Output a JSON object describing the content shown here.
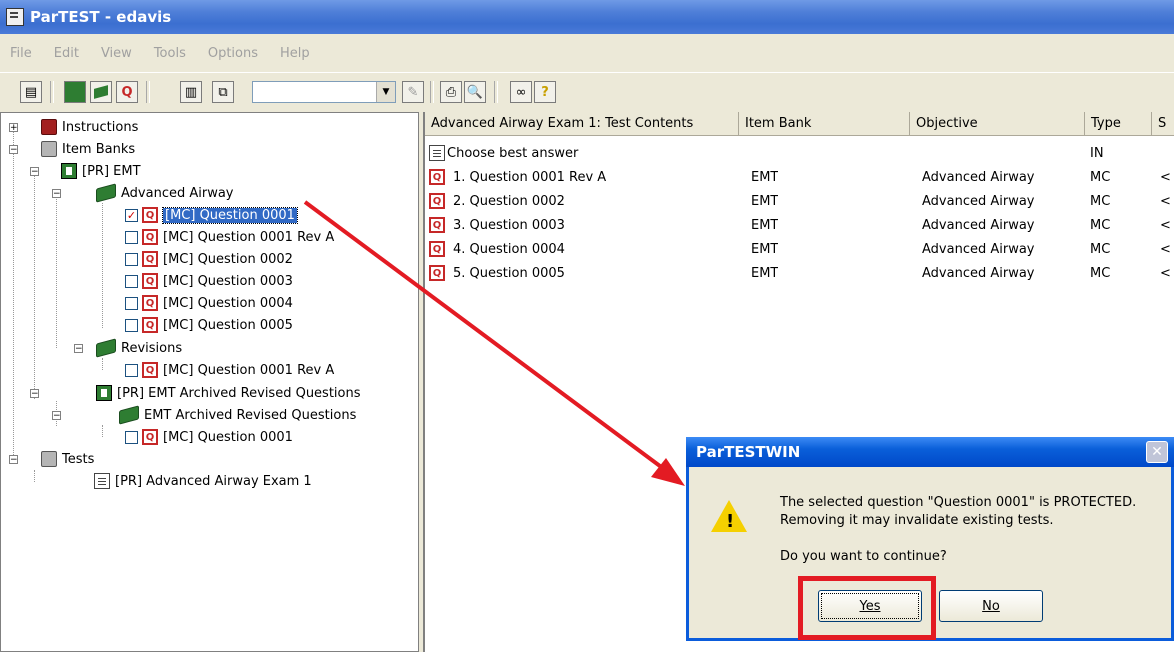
{
  "window": {
    "title": "ParTEST - edavis"
  },
  "menu": [
    "File",
    "Edit",
    "View",
    "Tools",
    "Options",
    "Help"
  ],
  "tree": {
    "instructions": "Instructions",
    "item_banks": "Item Banks",
    "emt_bank": "[PR] EMT",
    "advanced_airway": "Advanced Airway",
    "questions": [
      "[MC] Question 0001",
      "[MC] Question 0001 Rev A",
      "[MC] Question 0002",
      "[MC] Question 0003",
      "[MC] Question 0004",
      "[MC] Question 0005"
    ],
    "revisions": "Revisions",
    "revision_item": "[MC] Question 0001 Rev A",
    "archived_bank": "[PR] EMT Archived Revised Questions",
    "archived_objective": "EMT Archived Revised Questions",
    "archived_item": "[MC] Question 0001",
    "tests": "Tests",
    "test_item": "[PR] Advanced Airway Exam 1"
  },
  "grid": {
    "headers": [
      "Advanced Airway Exam 1: Test Contents",
      "Item Bank",
      "Objective",
      "Type",
      "S"
    ],
    "rows": [
      {
        "name": "Choose best answer",
        "bank": "",
        "objective": "",
        "type": "IN",
        "extra": ""
      },
      {
        "name": "1. Question 0001 Rev A",
        "bank": "EMT",
        "objective": "Advanced Airway",
        "type": "MC",
        "extra": "<"
      },
      {
        "name": "2. Question 0002",
        "bank": "EMT",
        "objective": "Advanced Airway",
        "type": "MC",
        "extra": "<"
      },
      {
        "name": "3. Question 0003",
        "bank": "EMT",
        "objective": "Advanced Airway",
        "type": "MC",
        "extra": "<"
      },
      {
        "name": "4. Question 0004",
        "bank": "EMT",
        "objective": "Advanced Airway",
        "type": "MC",
        "extra": "<"
      },
      {
        "name": "5. Question 0005",
        "bank": "EMT",
        "objective": "Advanced Airway",
        "type": "MC",
        "extra": "<"
      }
    ]
  },
  "dialog": {
    "title": "ParTESTWIN",
    "line1": "The selected question \"Question 0001\" is PROTECTED.",
    "line2": "Removing it may invalidate existing tests.",
    "line3": "Do you want to continue?",
    "yes": "Yes",
    "no": "No"
  },
  "colors": {
    "highlight": "#e31b23",
    "titlebar": "#3b6fd0",
    "selection": "#316ac5"
  }
}
